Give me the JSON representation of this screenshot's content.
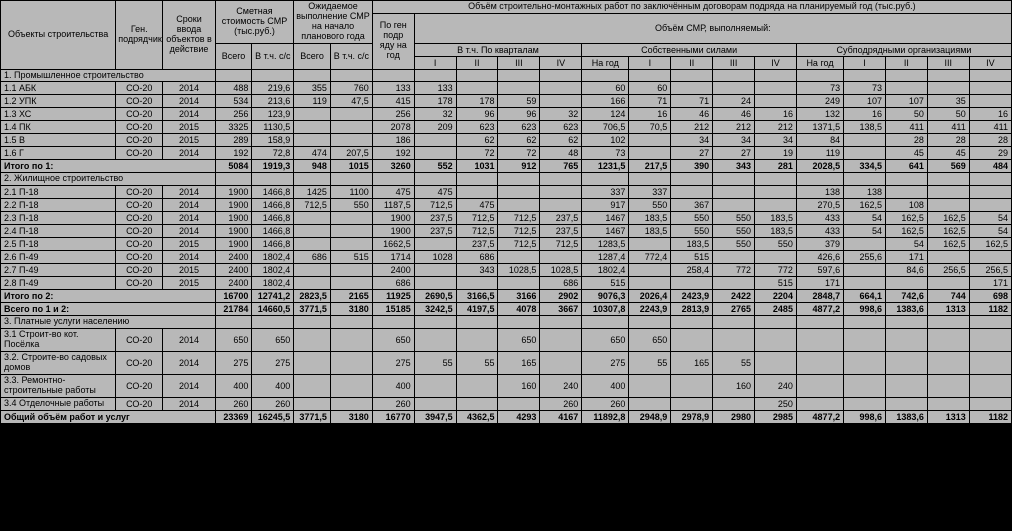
{
  "headers": {
    "c1": "Объекты строительства",
    "c2": "Ген. подрядчик",
    "c3": "Сроки ввода объектов в действие",
    "c4": "Сметная стоимость СМР (тыс.руб.)",
    "c5": "Ожидаемое выполнение СМР на начало планового года",
    "c6": "Объём строительно-монтажных работ по заключённым договорам подряда на планируемый год (тыс.руб.)",
    "vsego": "Всего",
    "vtchss": "В т.ч. с/с",
    "genpodr": "По ген подр яду на год",
    "smr_exec": "Объём СМР, выполняемый:",
    "kvartal": "В т.ч. По кварталам",
    "kvartal2": "по кварталам",
    "own": "Собственными силами",
    "sub": "Субподрядными организациями",
    "nagod": "На год",
    "q1": "I",
    "q2": "II",
    "q3": "III",
    "q4": "IV"
  },
  "sections": {
    "s1": "1. Промышленное строительство",
    "s2": "2. Жилищное строительство",
    "s3": "3. Платные услуги населению",
    "r31": "3.1 Строит-во кот. Посёлка",
    "r32": "3.2. Строите-во садовых домов",
    "r33": "3.3. Ремонтно-строительные работы",
    "r34": "3.4 Отделочные работы",
    "total1": "Итого по 1:",
    "total2": "Итого по 2:",
    "total12": "Всего по 1 и 2:",
    "grand": "Общий объём работ и услуг"
  },
  "rows": {
    "r11": {
      "name": "1.1 АБК",
      "gen": "СО-20",
      "yr": "2014",
      "v": [
        "488",
        "219,6",
        "355",
        "760",
        "133",
        "133",
        "",
        "",
        "",
        "60",
        "60",
        "",
        "",
        "",
        "73",
        "73",
        "",
        "",
        ""
      ]
    },
    "r12": {
      "name": "1.2 УПК",
      "gen": "СО-20",
      "yr": "2014",
      "v": [
        "534",
        "213,6",
        "119",
        "47,5",
        "415",
        "178",
        "178",
        "59",
        "",
        "166",
        "71",
        "71",
        "24",
        "",
        "249",
        "107",
        "107",
        "35",
        ""
      ]
    },
    "r13": {
      "name": "1.3 ХС",
      "gen": "СО-20",
      "yr": "2014",
      "v": [
        "256",
        "123,9",
        "",
        "",
        "256",
        "32",
        "96",
        "96",
        "32",
        "124",
        "16",
        "46",
        "46",
        "16",
        "132",
        "16",
        "50",
        "50",
        "16"
      ]
    },
    "r14": {
      "name": "1.4 ПК",
      "gen": "СО-20",
      "yr": "2015",
      "v": [
        "3325",
        "1130,5",
        "",
        "",
        "2078",
        "209",
        "623",
        "623",
        "623",
        "706,5",
        "70,5",
        "212",
        "212",
        "212",
        "1371,5",
        "138,5",
        "411",
        "411",
        "411"
      ]
    },
    "r15": {
      "name": "1.5 В",
      "gen": "СО-20",
      "yr": "2015",
      "v": [
        "289",
        "158,9",
        "",
        "",
        "186",
        "",
        "62",
        "62",
        "62",
        "102",
        "",
        "34",
        "34",
        "34",
        "84",
        "",
        "28",
        "28",
        "28"
      ]
    },
    "r16": {
      "name": "1.6 Г",
      "gen": "СО-20",
      "yr": "2014",
      "v": [
        "192",
        "72,8",
        "474",
        "207,5",
        "192",
        "",
        "72",
        "72",
        "48",
        "73",
        "",
        "27",
        "27",
        "19",
        "119",
        "",
        "45",
        "45",
        "29"
      ]
    },
    "t1": {
      "v": [
        "5084",
        "1919,3",
        "948",
        "1015",
        "3260",
        "552",
        "1031",
        "912",
        "765",
        "1231,5",
        "217,5",
        "390",
        "343",
        "281",
        "2028,5",
        "334,5",
        "641",
        "569",
        "484"
      ]
    },
    "r21": {
      "name": "2.1 П-18",
      "gen": "СО-20",
      "yr": "2014",
      "v": [
        "1900",
        "1466,8",
        "1425",
        "1100",
        "475",
        "475",
        "",
        "",
        "",
        "337",
        "337",
        "",
        "",
        "",
        "138",
        "138",
        "",
        "",
        ""
      ]
    },
    "r22": {
      "name": "2.2 П-18",
      "gen": "СО-20",
      "yr": "2014",
      "v": [
        "1900",
        "1466,8",
        "712,5",
        "550",
        "1187,5",
        "712,5",
        "475",
        "",
        "",
        "917",
        "550",
        "367",
        "",
        "",
        "270,5",
        "162,5",
        "108",
        "",
        ""
      ]
    },
    "r23": {
      "name": "2.3 П-18",
      "gen": "СО-20",
      "yr": "2014",
      "v": [
        "1900",
        "1466,8",
        "",
        "",
        "1900",
        "237,5",
        "712,5",
        "712,5",
        "237,5",
        "1467",
        "183,5",
        "550",
        "550",
        "183,5",
        "433",
        "54",
        "162,5",
        "162,5",
        "54"
      ]
    },
    "r24": {
      "name": "2.4 П-18",
      "gen": "СО-20",
      "yr": "2014",
      "v": [
        "1900",
        "1466,8",
        "",
        "",
        "1900",
        "237,5",
        "712,5",
        "712,5",
        "237,5",
        "1467",
        "183,5",
        "550",
        "550",
        "183,5",
        "433",
        "54",
        "162,5",
        "162,5",
        "54"
      ]
    },
    "r25": {
      "name": "2.5 П-18",
      "gen": "СО-20",
      "yr": "2015",
      "v": [
        "1900",
        "1466,8",
        "",
        "",
        "1662,5",
        "",
        "237,5",
        "712,5",
        "712,5",
        "1283,5",
        "",
        "183,5",
        "550",
        "550",
        "379",
        "",
        "54",
        "162,5",
        "162,5"
      ]
    },
    "r26": {
      "name": "2.6 П-49",
      "gen": "СО-20",
      "yr": "2014",
      "v": [
        "2400",
        "1802,4",
        "686",
        "515",
        "1714",
        "1028",
        "686",
        "",
        "",
        "1287,4",
        "772,4",
        "515",
        "",
        "",
        "426,6",
        "255,6",
        "171",
        "",
        ""
      ]
    },
    "r27": {
      "name": "2.7 П-49",
      "gen": "СО-20",
      "yr": "2015",
      "v": [
        "2400",
        "1802,4",
        "",
        "",
        "2400",
        "",
        "343",
        "1028,5",
        "1028,5",
        "1802,4",
        "",
        "258,4",
        "772",
        "772",
        "597,6",
        "",
        "84,6",
        "256,5",
        "256,5"
      ]
    },
    "r28": {
      "name": "2.8 П-49",
      "gen": "СО-20",
      "yr": "2015",
      "v": [
        "2400",
        "1802,4",
        "",
        "",
        "686",
        "",
        "",
        "",
        "686",
        "515",
        "",
        "",
        "",
        "515",
        "171",
        "",
        "",
        "",
        "171"
      ]
    },
    "t2": {
      "v": [
        "16700",
        "12741,2",
        "2823,5",
        "2165",
        "11925",
        "2690,5",
        "3166,5",
        "3166",
        "2902",
        "9076,3",
        "2026,4",
        "2423,9",
        "2422",
        "2204",
        "2848,7",
        "664,1",
        "742,6",
        "744",
        "698"
      ]
    },
    "t12": {
      "v": [
        "21784",
        "14660,5",
        "3771,5",
        "3180",
        "15185",
        "3242,5",
        "4197,5",
        "4078",
        "3667",
        "10307,8",
        "2243,9",
        "2813,9",
        "2765",
        "2485",
        "4877,2",
        "998,6",
        "1383,6",
        "1313",
        "1182"
      ]
    },
    "r31": {
      "gen": "СО-20",
      "yr": "2014",
      "v": [
        "650",
        "650",
        "",
        "",
        "650",
        "",
        "",
        "650",
        "",
        "650",
        "650",
        "",
        "",
        "",
        "",
        "",
        "",
        "",
        ""
      ]
    },
    "r32": {
      "gen": "СО-20",
      "yr": "2014",
      "v": [
        "275",
        "275",
        "",
        "",
        "275",
        "55",
        "55",
        "165",
        "",
        "275",
        "55",
        "165",
        "55",
        "",
        "",
        "",
        "",
        "",
        ""
      ]
    },
    "r33": {
      "gen": "СО-20",
      "yr": "2014",
      "v": [
        "400",
        "400",
        "",
        "",
        "400",
        "",
        "",
        "160",
        "240",
        "400",
        "",
        "",
        "160",
        "240",
        "",
        "",
        "",
        "",
        ""
      ]
    },
    "r34": {
      "gen": "СО-20",
      "yr": "2014",
      "v": [
        "260",
        "260",
        "",
        "",
        "260",
        "",
        "",
        "",
        "260",
        "260",
        "",
        "",
        "",
        "250",
        "",
        "",
        "",
        "",
        ""
      ]
    },
    "grand": {
      "v": [
        "23369",
        "16245,5",
        "3771,5",
        "3180",
        "16770",
        "3947,5",
        "4362,5",
        "4293",
        "4167",
        "11892,8",
        "2948,9",
        "2978,9",
        "2980",
        "2985",
        "4877,2",
        "998,6",
        "1383,6",
        "1313",
        "1182"
      ]
    }
  }
}
